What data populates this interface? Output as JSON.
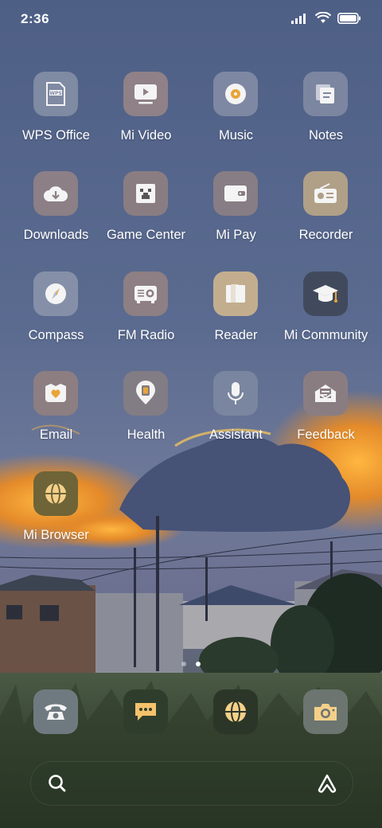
{
  "status_bar": {
    "time": "2:36"
  },
  "apps": [
    {
      "label": "WPS Office",
      "icon": "wps-office-icon",
      "color": "#7f8aa3"
    },
    {
      "label": "Mi Video",
      "icon": "mi-video-icon",
      "color": "#8f8187"
    },
    {
      "label": "Music",
      "icon": "music-icon",
      "color": "#7e88a2"
    },
    {
      "label": "Notes",
      "icon": "notes-icon",
      "color": "#7c86a0"
    },
    {
      "label": "Downloads",
      "icon": "download-icon",
      "color": "#8c7f86"
    },
    {
      "label": "Game Center",
      "icon": "game-center-icon",
      "color": "#8a7d82"
    },
    {
      "label": "Mi Pay",
      "icon": "wallet-icon",
      "color": "#877d85"
    },
    {
      "label": "Recorder",
      "icon": "radio-icon",
      "color": "#b0a088"
    },
    {
      "label": "Compass",
      "icon": "compass-icon",
      "color": "#8590a8"
    },
    {
      "label": "FM Radio",
      "icon": "fm-radio-icon",
      "color": "#8d7f83"
    },
    {
      "label": "Reader",
      "icon": "book-icon",
      "color": "#c2ae8f"
    },
    {
      "label": "Mi Community",
      "icon": "graduation-cap-icon",
      "color": "#414a5d"
    },
    {
      "label": "Email",
      "icon": "email-heart-icon",
      "color": "#8d7e82"
    },
    {
      "label": "Health",
      "icon": "health-icon",
      "color": "#827c84"
    },
    {
      "label": "Assistant",
      "icon": "microphone-icon",
      "color": "#7a86a0"
    },
    {
      "label": "Feedback",
      "icon": "feedback-icon",
      "color": "#8a7d82"
    },
    {
      "label": "Mi Browser",
      "icon": "browser-globe-icon",
      "color": "#6e6438"
    }
  ],
  "dock": [
    {
      "name": "phone",
      "icon": "phone-icon",
      "color": "#6f7a80"
    },
    {
      "name": "messages",
      "icon": "message-icon",
      "color": "#2f3d2c"
    },
    {
      "name": "browser",
      "icon": "browser-globe-icon",
      "color": "#2b3628"
    },
    {
      "name": "camera",
      "icon": "camera-icon",
      "color": "#6c7570"
    }
  ],
  "pager": {
    "pages": 2,
    "active": 1
  },
  "search_bar": {
    "left_icon": "search-icon",
    "right_icon": "app-vault-icon"
  }
}
